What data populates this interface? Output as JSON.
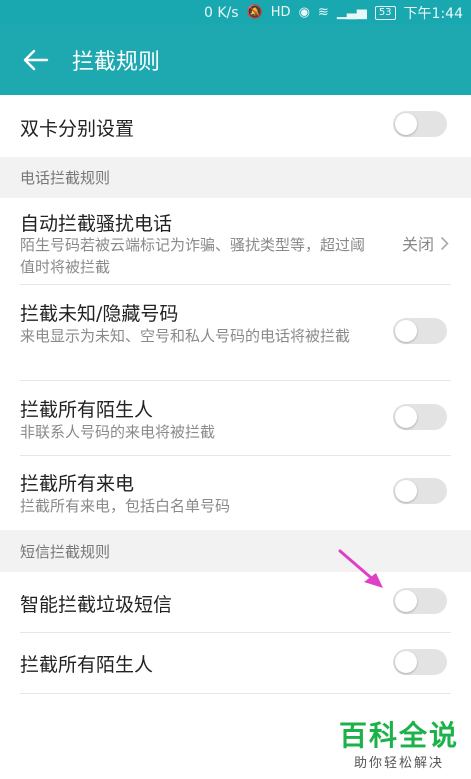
{
  "statusbar": {
    "net_speed": "0 K/s",
    "battery": "53",
    "time": "下午1:44",
    "color": "#1aa8b0"
  },
  "header": {
    "title": "拦截规则",
    "back_icon": "arrow-left-icon",
    "color": "#1ea9b1"
  },
  "settings": {
    "dual_sim": {
      "label": "双卡分别设置",
      "enabled": false
    }
  },
  "sections": {
    "call": {
      "title": "电话拦截规则"
    },
    "sms": {
      "title": "短信拦截规则"
    }
  },
  "call_rules": {
    "auto_block": {
      "label": "自动拦截骚扰电话",
      "desc": "陌生号码若被云端标记为诈骗、骚扰类型等，超过阈值时将被拦截",
      "value": "关闭"
    },
    "unknown": {
      "label": "拦截未知/隐藏号码",
      "desc": "来电显示为未知、空号和私人号码的电话将被拦截",
      "enabled": false
    },
    "strangers": {
      "label": "拦截所有陌生人",
      "desc": "非联系人号码的来电将被拦截",
      "enabled": false
    },
    "all": {
      "label": "拦截所有来电",
      "desc": "拦截所有来电，包括白名单号码",
      "enabled": false
    }
  },
  "sms_rules": {
    "spam": {
      "label": "智能拦截垃圾短信",
      "enabled": false
    },
    "strangers": {
      "label": "拦截所有陌生人",
      "enabled": false
    }
  },
  "watermark": {
    "main": "百科全说",
    "sub": "助你轻松解决"
  },
  "colors": {
    "toggle_off": "#e3e3e3",
    "annotation_arrow": "#e040c8",
    "watermark_green": "#1bb24a"
  }
}
